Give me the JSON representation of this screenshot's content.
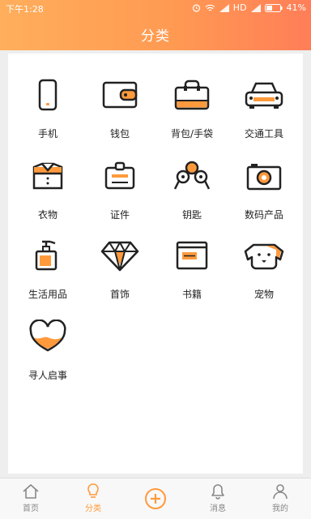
{
  "status": {
    "time": "下午1:28",
    "network": "HD",
    "battery": "41%"
  },
  "header": {
    "title": "分类"
  },
  "categories": [
    {
      "label": "手机",
      "icon": "phone-icon"
    },
    {
      "label": "钱包",
      "icon": "wallet-icon"
    },
    {
      "label": "背包/手袋",
      "icon": "bag-icon"
    },
    {
      "label": "交通工具",
      "icon": "car-icon"
    },
    {
      "label": "衣物",
      "icon": "shirt-icon"
    },
    {
      "label": "证件",
      "icon": "id-card-icon"
    },
    {
      "label": "钥匙",
      "icon": "keys-icon"
    },
    {
      "label": "数码产品",
      "icon": "camera-icon"
    },
    {
      "label": "生活用品",
      "icon": "soap-bottle-icon"
    },
    {
      "label": "首饰",
      "icon": "diamond-icon"
    },
    {
      "label": "书籍",
      "icon": "book-icon"
    },
    {
      "label": "宠物",
      "icon": "dog-icon"
    },
    {
      "label": "寻人启事",
      "icon": "heart-icon"
    }
  ],
  "tabs": [
    {
      "label": "首页",
      "icon": "home-icon"
    },
    {
      "label": "分类",
      "icon": "lightbulb-icon",
      "active": true
    },
    {
      "label": "",
      "icon": "plus-circle-icon"
    },
    {
      "label": "消息",
      "icon": "bell-icon"
    },
    {
      "label": "我的",
      "icon": "user-icon"
    }
  ],
  "colors": {
    "accent": "#ff9a3c",
    "header_start": "#ffae5c",
    "header_end": "#ff7e58",
    "icon_stroke": "#222222"
  }
}
